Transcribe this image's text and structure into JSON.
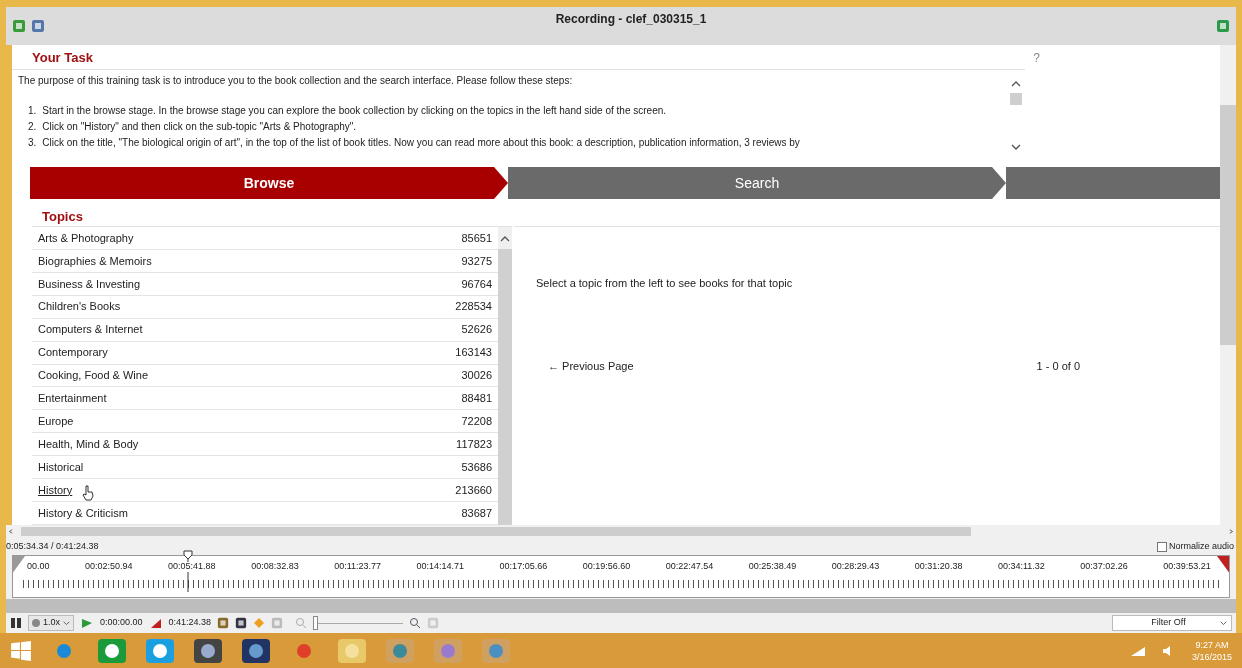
{
  "window": {
    "title": "Recording - clef_030315_1"
  },
  "task": {
    "heading": "Your Task",
    "help": "?",
    "intro": "The purpose of this training task is to introduce you to the book collection and the search interface. Please follow these steps:",
    "steps": [
      {
        "number": "1.",
        "text": "Start in the browse stage. In the browse stage you can explore the book collection by clicking on the topics in the left hand side of the screen."
      },
      {
        "number": "2.",
        "text": "Click on \"History\" and then click on the sub-topic \"Arts & Photography\"."
      },
      {
        "number": "3.",
        "text": "Click on the title, \"The biological origin of art\", in the top of the list of book titles. Now you can read more about this book: a description, publication information, 3 reviews by"
      }
    ]
  },
  "stages": [
    {
      "label": "Browse",
      "selected": true
    },
    {
      "label": "Search",
      "selected": false
    }
  ],
  "topics": {
    "heading": "Topics",
    "items": [
      {
        "name": "Arts & Photography",
        "count": "85651",
        "hovered": false
      },
      {
        "name": "Biographies & Memoirs",
        "count": "93275",
        "hovered": false
      },
      {
        "name": "Business & Investing",
        "count": "96764",
        "hovered": false
      },
      {
        "name": "Children's Books",
        "count": "228534",
        "hovered": false
      },
      {
        "name": "Computers & Internet",
        "count": "52626",
        "hovered": false
      },
      {
        "name": "Contemporary",
        "count": "163143",
        "hovered": false
      },
      {
        "name": "Cooking, Food & Wine",
        "count": "30026",
        "hovered": false
      },
      {
        "name": "Entertainment",
        "count": "88481",
        "hovered": false
      },
      {
        "name": "Europe",
        "count": "72208",
        "hovered": false
      },
      {
        "name": "Health, Mind & Body",
        "count": "117823",
        "hovered": false
      },
      {
        "name": "Historical",
        "count": "53686",
        "hovered": false
      },
      {
        "name": "History",
        "count": "213660",
        "hovered": true
      },
      {
        "name": "History & Criticism",
        "count": "83687",
        "hovered": false
      }
    ]
  },
  "results": {
    "message": "Select a topic from the left to see books for that topic",
    "previous": "← Previous Page",
    "range": "1 - 0 of 0"
  },
  "player": {
    "position": "0:05:34.34 / 0:41:24.38",
    "normalize": {
      "label": "Normalize audio",
      "checked": false
    },
    "ticks": [
      "00.00",
      "00:02:50.94",
      "00:05:41.88",
      "00:08:32.83",
      "00:11:23.77",
      "00:14:14.71",
      "00:17:05.66",
      "00:19:56.60",
      "00:22:47.54",
      "00:25:38.49",
      "00:28:29.43",
      "00:31:20.38",
      "00:34:11.32",
      "00:37:02.26",
      "00:39:53.21"
    ],
    "zoom": {
      "level": 0
    },
    "speed": "1.0x",
    "start": "0:00:00.00",
    "end": "0:41:24.38",
    "filter": "Filter Off"
  },
  "taskbar": {
    "time": "9:27 AM",
    "date": "3/16/2015"
  }
}
